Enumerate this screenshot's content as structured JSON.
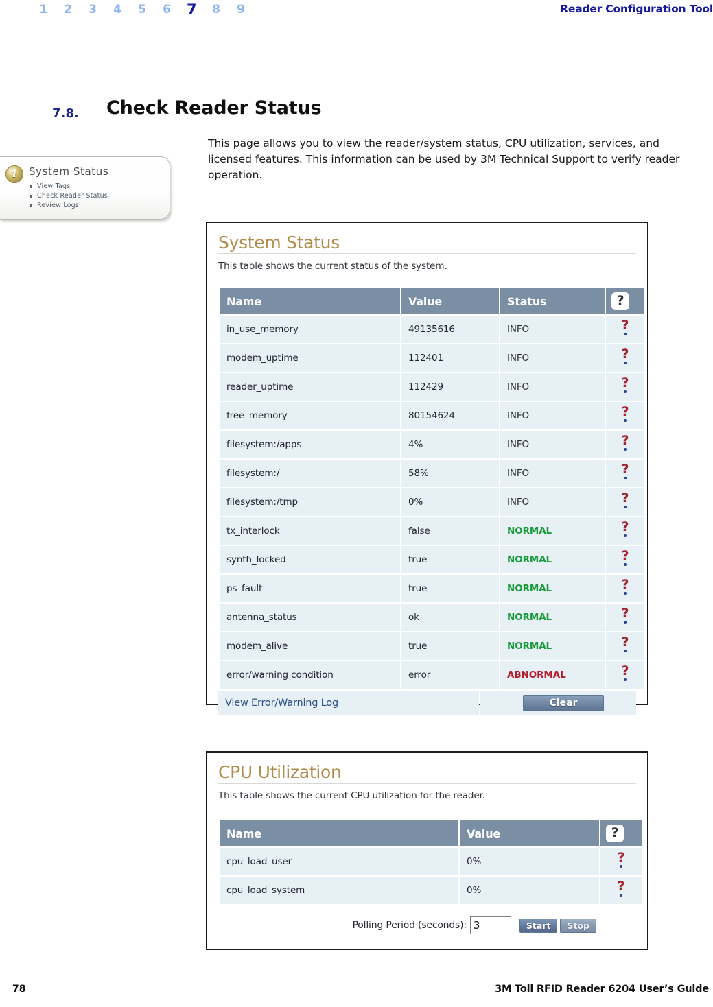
{
  "header": {
    "chapter_numbers": [
      "1",
      "2",
      "3",
      "4",
      "5",
      "6",
      "7",
      "8",
      "9"
    ],
    "active_chapter": "7",
    "doc_title": "Reader Configuration Tool"
  },
  "section": {
    "number": "7.8.",
    "title": "Check Reader Status",
    "intro": "This page allows you to view the reader/system status, CPU utilization, services, and licensed features. This information can be used by 3M Technical Support to verify reader operation."
  },
  "callout": {
    "icon": "info-icon",
    "title": "System Status",
    "items": [
      {
        "label": "View Tags"
      },
      {
        "label": "Check Reader Status"
      },
      {
        "label": "Review Logs"
      }
    ]
  },
  "system_status": {
    "title": "System Status",
    "description": "This table shows the current status of the system.",
    "columns": [
      "Name",
      "Value",
      "Status",
      "?"
    ],
    "rows": [
      {
        "name": "in_use_memory",
        "value": "49135616",
        "status": "INFO",
        "status_kind": "info"
      },
      {
        "name": "modem_uptime",
        "value": "112401",
        "status": "INFO",
        "status_kind": "info"
      },
      {
        "name": "reader_uptime",
        "value": "112429",
        "status": "INFO",
        "status_kind": "info"
      },
      {
        "name": "free_memory",
        "value": "80154624",
        "status": "INFO",
        "status_kind": "info"
      },
      {
        "name": "filesystem:/apps",
        "value": "4%",
        "status": "INFO",
        "status_kind": "info"
      },
      {
        "name": "filesystem:/",
        "value": "58%",
        "status": "INFO",
        "status_kind": "info"
      },
      {
        "name": "filesystem:/tmp",
        "value": "0%",
        "status": "INFO",
        "status_kind": "info"
      },
      {
        "name": "tx_interlock",
        "value": "false",
        "status": "NORMAL",
        "status_kind": "normal"
      },
      {
        "name": "synth_locked",
        "value": "true",
        "status": "NORMAL",
        "status_kind": "normal"
      },
      {
        "name": "ps_fault",
        "value": "true",
        "status": "NORMAL",
        "status_kind": "normal"
      },
      {
        "name": "antenna_status",
        "value": "ok",
        "status": "NORMAL",
        "status_kind": "normal"
      },
      {
        "name": "modem_alive",
        "value": "true",
        "status": "NORMAL",
        "status_kind": "normal"
      },
      {
        "name": "error/warning condition",
        "value": "error",
        "status": "ABNORMAL",
        "status_kind": "abnormal"
      }
    ],
    "view_log_link": "View Error/Warning Log",
    "clear_button": "Clear"
  },
  "cpu_utilization": {
    "title": "CPU Utilization",
    "description": "This table shows the current CPU utilization for the reader.",
    "columns": [
      "Name",
      "Value",
      "?"
    ],
    "rows": [
      {
        "name": "cpu_load_user",
        "value": "0%"
      },
      {
        "name": "cpu_load_system",
        "value": "0%"
      }
    ],
    "polling_label": "Polling Period (seconds):",
    "polling_value": "3",
    "start_button": "Start",
    "stop_button": "Stop"
  },
  "footer": {
    "page_number": "78",
    "guide_title": "3M Toll RFID Reader 6204 User’s Guide"
  },
  "colors": {
    "table_header": "#7b8fa4",
    "row_bg": "#e7f0f4",
    "panel_title": "#b08d4a",
    "normal": "#179b3a",
    "abnormal": "#b51b2a",
    "accent_nav": "#8fb4ef",
    "accent_nav_active": "#151a9e",
    "link": "#2b4f86"
  }
}
